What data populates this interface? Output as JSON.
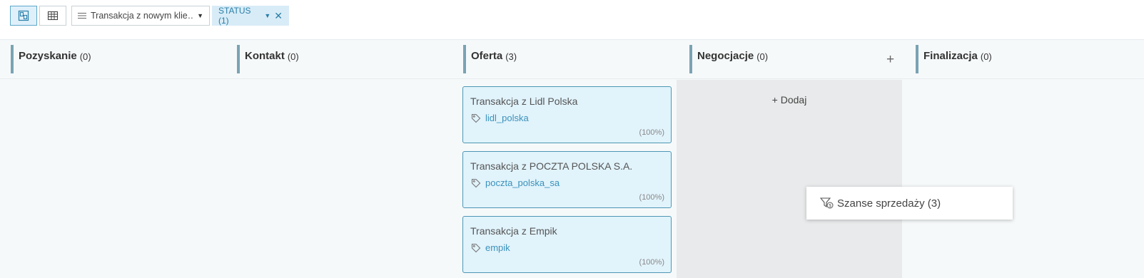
{
  "toolbar": {
    "view_toggle": [
      {
        "name": "kanban-view",
        "icon": "kanban-icon",
        "active": true
      },
      {
        "name": "table-view",
        "icon": "table-icon",
        "active": false
      }
    ],
    "pipeline_select": {
      "value": "Transakcja z nowym klie…",
      "icon": "list-lines-icon"
    },
    "filter_chip": {
      "label": "STATUS (1)",
      "icon": "close-icon"
    }
  },
  "columns": [
    {
      "title": "Pozyskanie",
      "count": "(0)"
    },
    {
      "title": "Kontakt",
      "count": "(0)"
    },
    {
      "title": "Oferta",
      "count": "(3)"
    },
    {
      "title": "Negocjacje",
      "count": "(0)",
      "add_symbol": "+"
    },
    {
      "title": "Finalizacja",
      "count": "(0)"
    }
  ],
  "negocjacje_add_link": "+ Dodaj",
  "cards": [
    {
      "title": "Transakcja z Lidl Polska",
      "tag": "lidl_polska",
      "percent": "(100%)"
    },
    {
      "title": "Transakcja z POCZTA POLSKA S.A.",
      "tag": "poczta_polska_sa",
      "percent": "(100%)"
    },
    {
      "title": "Transakcja z Empik",
      "tag": "empik",
      "percent": "(100%)"
    }
  ],
  "popup": {
    "label": "Szanse sprzedaży (3)",
    "icon": "filter-dollar-icon"
  },
  "colors": {
    "accent": "#4d97b5",
    "card_bg": "#e1f3fb",
    "column_bar": "#7aa3b4",
    "chip_bg": "#d8ecf7",
    "tag_text": "#3a91bb"
  }
}
